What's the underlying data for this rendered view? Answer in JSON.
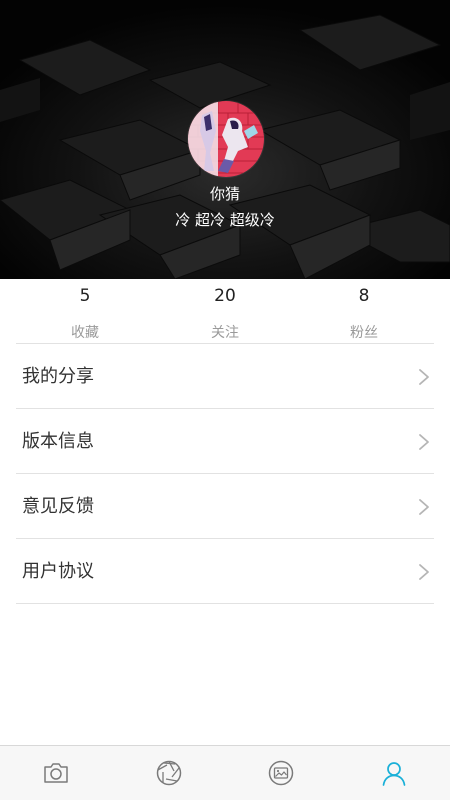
{
  "profile": {
    "username": "你猜",
    "signature": "冷 超冷 超级冷"
  },
  "stats": [
    {
      "value": "5",
      "label": "收藏"
    },
    {
      "value": "20",
      "label": "关注"
    },
    {
      "value": "8",
      "label": "粉丝"
    }
  ],
  "menu": [
    {
      "label": "我的分享"
    },
    {
      "label": "版本信息"
    },
    {
      "label": "意见反馈"
    },
    {
      "label": "用户协议"
    }
  ],
  "tabbar": {
    "tabs": [
      {
        "icon": "camera-icon",
        "active": false
      },
      {
        "icon": "aperture-icon",
        "active": false
      },
      {
        "icon": "gallery-icon",
        "active": false
      },
      {
        "icon": "user-icon",
        "active": true
      }
    ],
    "active_color": "#1ab0d8",
    "inactive_color": "#7a7a7a"
  },
  "colors": {
    "header_bg": "#050505",
    "divider": "#e2e2e2",
    "label_gray": "#9a9a9a"
  }
}
